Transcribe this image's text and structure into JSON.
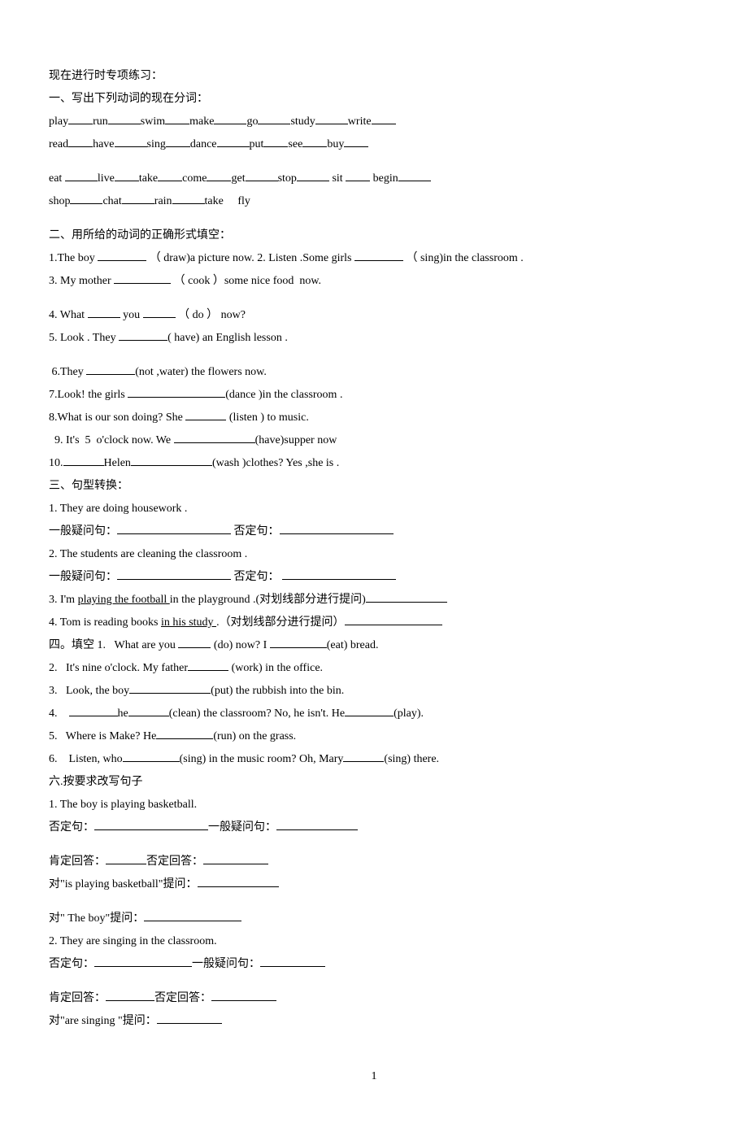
{
  "title": "现在进行时专项练习：",
  "section1": {
    "heading": "一、写出下列动词的现在分词：",
    "words_row1": [
      "play",
      "run",
      "swim",
      "make",
      "go",
      "study",
      "write"
    ],
    "words_row2": [
      "read",
      "have",
      "sing",
      "dance",
      "put",
      "see",
      "buy"
    ],
    "words_row3": [
      "eat ",
      "live",
      "take",
      "come",
      "get",
      "stop",
      " sit ",
      " begin"
    ],
    "words_row4": [
      "shop",
      "chat",
      "rain",
      "take     fly"
    ]
  },
  "section2": {
    "heading": "二、用所给的动词的正确形式填空：",
    "q1a": "1.The boy ",
    "q1b": " （ draw)a picture now. 2. Listen .Some girls ",
    "q1c": " （ sing)in the classroom .",
    "q3a": "3. My mother ",
    "q3b": " （ cook ）some nice food  now.",
    "q4a": "4. What ",
    "q4b": " you ",
    "q4c": " （ do ） now?",
    "q5a": "5. Look . They ",
    "q5b": "( have) an English lesson .",
    "q6a": " 6.They ",
    "q6b": "(not ,water) the flowers now.",
    "q7a": "7.Look! the girls ",
    "q7b": "(dance )in the classroom .",
    "q8a": "8.What is our son doing? She ",
    "q8b": " (listen ) to music.",
    "q9a": "  9. It's  5  o'clock now. We ",
    "q9b": "(have)supper now",
    "q10a": "10.",
    "q10b": "Helen",
    "q10c": "(wash )clothes? Yes ,she is ."
  },
  "section3": {
    "heading": "三、句型转换：",
    "q1": "1. They are doing housework .",
    "label_yibanwenju": "一般疑问句：",
    "label_foudingju": " 否定句：",
    "label_foudingju_space": " 否定句： ",
    "q2": "2. The students are cleaning the classroom .",
    "q3a": "3. I'm ",
    "q3_underline": "playing the football ",
    "q3b": "in the playground .(对划线部分进行提问)",
    "q4a": "4. Tom is reading books ",
    "q4_underline": "in his study ",
    "q4b": ".（对划线部分进行提问）"
  },
  "section4": {
    "heading_inline": "四。填空 1.   What are you ",
    "q1b": " (do) now? I ",
    "q1c": "(eat) bread.",
    "q2a": "2.   It's nine o'clock. My father",
    "q2b": " (work) in the office.",
    "q3a": "3.   Look, the boy",
    "q3b": "(put) the rubbish into the bin.",
    "q4a": "4.    ",
    "q4b": "he",
    "q4c": "(clean) the classroom? No, he isn't. He",
    "q4d": "(play).",
    "q5a": "5.   Where is Make? He",
    "q5b": "(run) on the grass.",
    "q6a": "6.    Listen, who",
    "q6b": "(sing) in the music room? Oh, Mary",
    "q6c": "(sing) there."
  },
  "section6": {
    "heading": "六.按要求改写句子",
    "q1": "1. The boy is playing basketball.",
    "label_fouding": "否定句：",
    "label_yiban": "一般疑问句：",
    "label_kend": "肯定回答：",
    "label_foudhd": "否定回答：",
    "prompt1a": "对\"is playing basketball\"提问：",
    "prompt1b": "对\" The boy\"提问：",
    "q2": "2. They are singing in the classroom.",
    "prompt2a": "对\"are singing \"提问："
  },
  "page_number": "1"
}
